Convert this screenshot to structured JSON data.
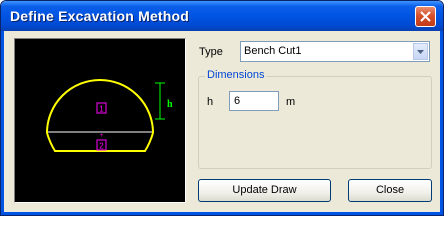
{
  "window": {
    "title": "Define Excavation Method"
  },
  "preview": {
    "dimension_label": "h",
    "section_labels": [
      "1",
      "2"
    ],
    "colors": {
      "outline": "#ffff00",
      "labels": "#ff00ff",
      "dimension": "#00ff00",
      "background": "#000000"
    }
  },
  "type_field": {
    "label": "Type",
    "selected": "Bench Cut1"
  },
  "dimensions": {
    "group_title": "Dimensions",
    "h_label": "h",
    "h_value": "6",
    "unit": "m"
  },
  "buttons": {
    "update": "Update Draw",
    "close": "Close"
  },
  "icons": {
    "close_window": "close-icon",
    "dropdown": "chevron-down-icon"
  }
}
